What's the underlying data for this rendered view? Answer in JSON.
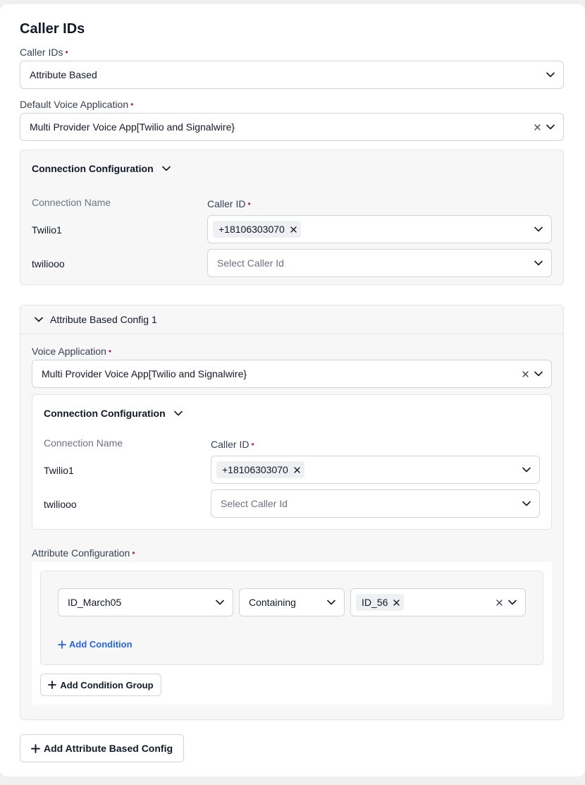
{
  "page": {
    "title": "Caller IDs"
  },
  "caller_ids_field": {
    "label": "Caller IDs",
    "value": "Attribute Based"
  },
  "default_voice_app": {
    "label": "Default Voice Application",
    "value": "Multi Provider Voice App[Twilio and Signalwire}"
  },
  "connection_config": {
    "title": "Connection Configuration",
    "col_connection": "Connection Name",
    "col_caller_id": "Caller ID",
    "rows": [
      {
        "name": "Twilio1",
        "chip": "+18106303070"
      },
      {
        "name": "twiliooo",
        "placeholder": "Select Caller Id"
      }
    ]
  },
  "attr_config_1": {
    "title": "Attribute Based Config 1",
    "voice_app_label": "Voice Application",
    "voice_app_value": "Multi Provider Voice App[Twilio and Signalwire}",
    "connection_config": {
      "title": "Connection Configuration",
      "col_connection": "Connection Name",
      "col_caller_id": "Caller ID",
      "rows": [
        {
          "name": "Twilio1",
          "chip": "+18106303070"
        },
        {
          "name": "twiliooo",
          "placeholder": "Select Caller Id"
        }
      ]
    },
    "attribute_configuration": {
      "label": "Attribute Configuration",
      "attribute": "ID_March05",
      "operator": "Containing",
      "value_chip": "ID_56",
      "add_condition": "Add Condition",
      "add_condition_group": "Add Condition Group"
    }
  },
  "add_attribute_config_button": "Add Attribute Based Config",
  "icons": {
    "chevron": "chevron-down-icon",
    "clear": "close-icon",
    "plus": "plus-icon"
  },
  "colors": {
    "required": "#be185d",
    "link": "#2563eb"
  }
}
